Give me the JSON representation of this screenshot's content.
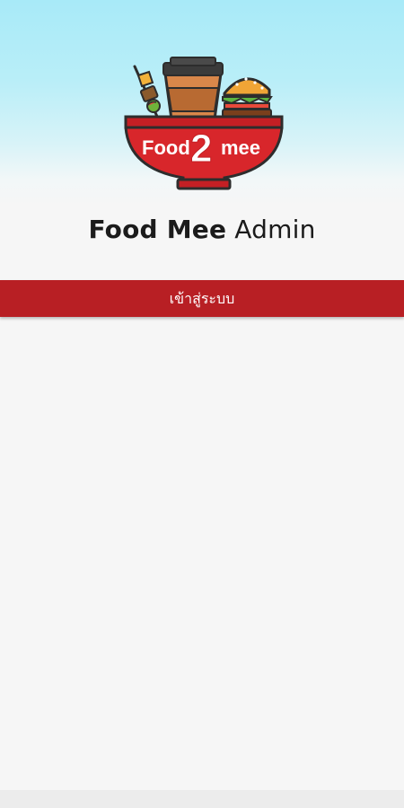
{
  "app": {
    "logo_text_left": "Food",
    "logo_text_number": "2",
    "logo_text_right": "mee",
    "title_bold": "Food Mee",
    "title_light": "Admin"
  },
  "login": {
    "label": "เข้าสู่ระบบ"
  },
  "colors": {
    "brand_red": "#b81f24",
    "sky_top": "#a8eaf8",
    "background": "#f6f6f6"
  }
}
